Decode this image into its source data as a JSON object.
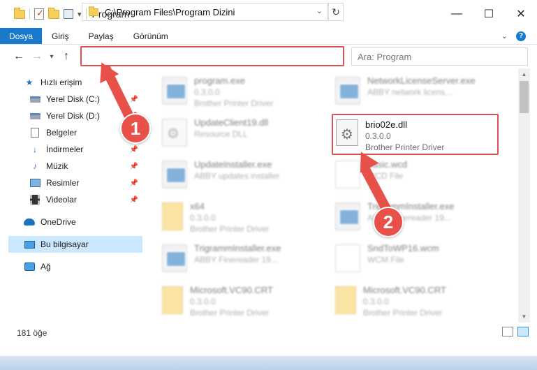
{
  "window": {
    "title": "Program",
    "controls": {
      "minimize": "—",
      "maximize": "☐",
      "close": "✕"
    }
  },
  "ribbon": {
    "tabs": [
      {
        "label": "Dosya",
        "active": true
      },
      {
        "label": "Giriş"
      },
      {
        "label": "Paylaş"
      },
      {
        "label": "Görünüm"
      }
    ],
    "help": "?"
  },
  "address": {
    "path": "C:\\Program Files\\Program Dizini",
    "search_placeholder": "Ara: Program"
  },
  "sidebar": {
    "items": [
      {
        "label": "Hızlı erişim",
        "icon": "star-icon"
      },
      {
        "label": "Yerel Disk (C:)",
        "icon": "disk-icon",
        "pinned": true
      },
      {
        "label": "Yerel Disk (D:)",
        "icon": "disk-icon",
        "pinned": true
      },
      {
        "label": "Belgeler",
        "icon": "document-icon",
        "pinned": true
      },
      {
        "label": "İndirmeler",
        "icon": "download-icon",
        "pinned": true
      },
      {
        "label": "Müzik",
        "icon": "music-icon",
        "pinned": true
      },
      {
        "label": "Resimler",
        "icon": "pictures-icon",
        "pinned": true
      },
      {
        "label": "Videolar",
        "icon": "video-icon",
        "pinned": true
      },
      {
        "label": "OneDrive",
        "icon": "onedrive-icon"
      },
      {
        "label": "Bu bilgisayar",
        "icon": "computer-icon",
        "selected": true
      },
      {
        "label": "Ağ",
        "icon": "network-icon"
      }
    ]
  },
  "files": [
    {
      "name": "program.exe",
      "line2": "0.3.0.0",
      "line3": "Brother Printer Driver",
      "icon": "exe"
    },
    {
      "name": "NetworkLicenseServer.exe",
      "line2": "ABBY network licens...",
      "line3": "",
      "icon": "exe"
    },
    {
      "name": "UpdateClient19.dll",
      "line2": "Resource DLL",
      "line3": "",
      "icon": "dll"
    },
    {
      "name": "brio02e.dll",
      "line2": "0.3.0.0",
      "line3": "Brother Printer Driver",
      "icon": "dll",
      "highlighted": true
    },
    {
      "name": "UpdateInstaller.exe",
      "line2": "ABBY updates installer",
      "line3": "",
      "icon": "exe"
    },
    {
      "name": "basic.wcd",
      "line2": "WCD File",
      "line3": "",
      "icon": "page"
    },
    {
      "name": "x64",
      "line2": "0.3.0.0",
      "line3": "Brother Printer Driver",
      "icon": "folder"
    },
    {
      "name": "TrigrammInstaller.exe",
      "line2": "ABBY Finereader 19...",
      "line3": "",
      "icon": "exe"
    },
    {
      "name": "TrigrammInstaller.exe",
      "line2": "ABBY Finereader 19...",
      "line3": "",
      "icon": "exe"
    },
    {
      "name": "SndToWP16.wcm",
      "line2": "WCM File",
      "line3": "",
      "icon": "page"
    },
    {
      "name": "Microsoft.VC90.CRT",
      "line2": "0.3.0.0",
      "line3": "Brother Printer Driver",
      "icon": "folder"
    },
    {
      "name": "Microsoft.VC90.CRT",
      "line2": "0.3.0.0",
      "line3": "Brother Printer Driver",
      "icon": "folder"
    }
  ],
  "status": {
    "count": "181 öğe"
  },
  "annotations": {
    "step1": "1",
    "step2": "2"
  },
  "colors": {
    "accent": "#1979ca",
    "annotation": "#e8504a",
    "selection": "#cce8ff"
  }
}
